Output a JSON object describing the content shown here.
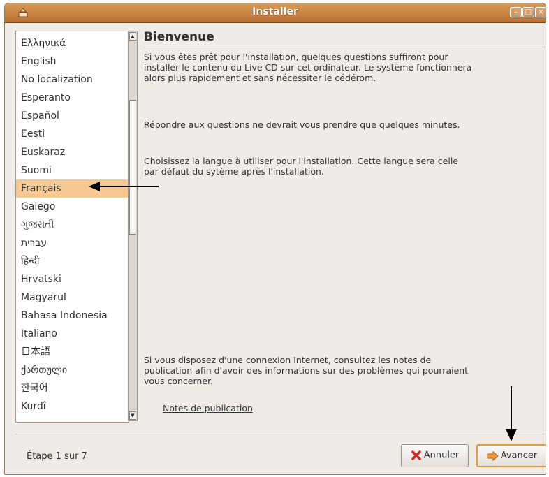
{
  "window": {
    "title": "Installer"
  },
  "languages": [
    "Ελληνικά",
    "English",
    "No localization",
    "Esperanto",
    "Español",
    "Eesti",
    "Euskaraz",
    "Suomi",
    "Français",
    "Galego",
    "ગુજરાતી",
    "עברית",
    "हिन्दी",
    "Hrvatski",
    "Magyarul",
    "Bahasa Indonesia",
    "Italiano",
    "日本語",
    "ქართული",
    "한국어",
    "Kurdî"
  ],
  "selected_language": "Français",
  "main": {
    "heading": "Bienvenue",
    "paragraph1": "Si vous êtes prêt pour l'installation, quelques questions suffiront pour installer le contenu du Live CD sur cet ordinateur. Le système fonctionnera alors plus rapidement et sans nécessiter le cédérom.",
    "paragraph2": "Répondre aux questions ne devrait vous prendre que quelques minutes.",
    "paragraph3": "Choisissez la langue à utiliser pour l'installation. Cette langue sera celle par défaut du sytème après l'installation.",
    "paragraph4": "Si vous disposez d'une connexion Internet, consultez les notes de publication afin d'avoir des informations sur des problèmes qui pourraient vous concerner.",
    "release_notes_link": "Notes de publication"
  },
  "footer": {
    "status": "Étape 1 sur 7",
    "cancel_label": "Annuler",
    "next_label": "Avancer"
  },
  "colors": {
    "titlebar": "#c9803f",
    "selection": "#f5c991",
    "next_border": "#e79a3c"
  }
}
